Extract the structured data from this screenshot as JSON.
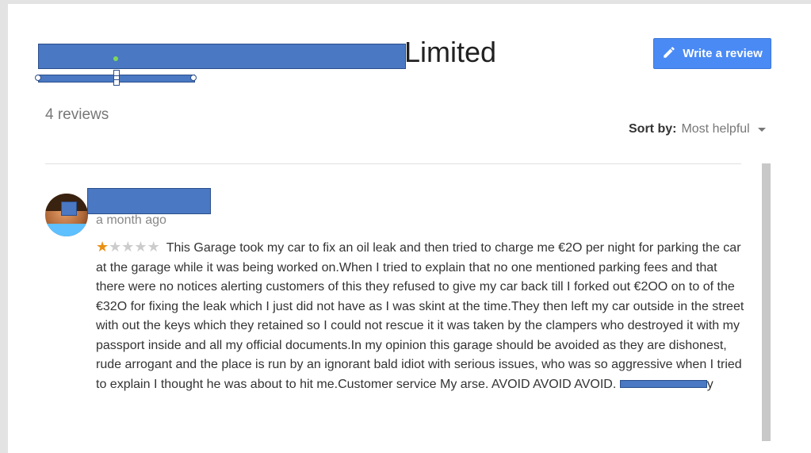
{
  "business": {
    "title_suffix": "Limited"
  },
  "actions": {
    "write_review_label": "Write a review"
  },
  "reviews_summary": {
    "count_text": "4 reviews"
  },
  "sort": {
    "label": "Sort by:",
    "value": "Most helpful"
  },
  "review": {
    "date": "a month ago",
    "rating": 1,
    "rating_max": 5,
    "text": "This Garage took my car to fix an oil leak and then tried to charge me €2O per night for parking the car at the garage while it was being worked on.When I tried to explain that no one mentioned parking fees and that there were no notices alerting customers of this they refused to give my car back till I forked out €2OO on to of the €32O for fixing the leak which I just did not have as I was skint at the time.They then left my car outside in the street with out the keys which they retained so I could not rescue it  it was taken by the clampers who destroyed it with my passport inside and all my official documents.In my opinion this garage should be avoided as they are dishonest, rude arrogant and the place is run by an ignorant  bald idiot with serious issues, who was so aggressive when I tried to explain I thought he was about to hit me.Customer service My arse. AVOID AVOID AVOID.",
    "signature_tail": "y"
  },
  "colors": {
    "accent": "#4a8af4",
    "star_filled": "#e98f12",
    "star_empty": "#cccccc",
    "redaction": "#4a78c2"
  },
  "icons": {
    "write": "pencil-icon",
    "sort": "caret-down-icon",
    "star": "star-icon"
  }
}
